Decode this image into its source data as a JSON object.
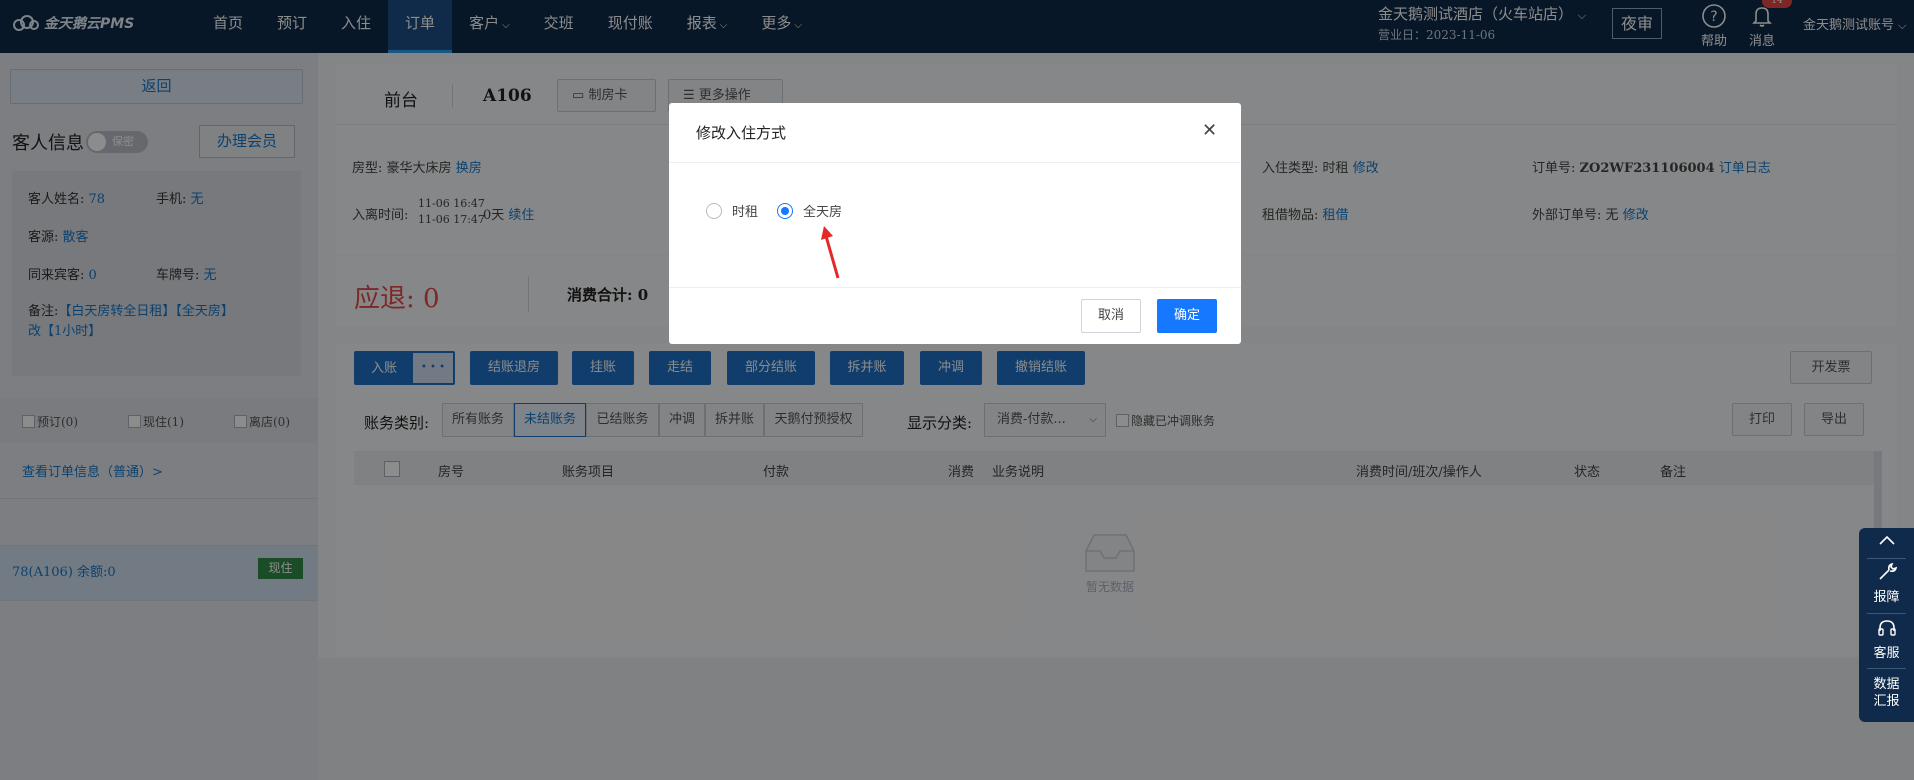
{
  "brand": {
    "name": "金天鹅云PMS"
  },
  "nav": [
    {
      "label": "首页",
      "dropdown": false,
      "active": false
    },
    {
      "label": "预订",
      "dropdown": false,
      "active": false
    },
    {
      "label": "入住",
      "dropdown": false,
      "active": false
    },
    {
      "label": "订单",
      "dropdown": false,
      "active": true
    },
    {
      "label": "客户",
      "dropdown": true,
      "active": false
    },
    {
      "label": "交班",
      "dropdown": false,
      "active": false
    },
    {
      "label": "现付账",
      "dropdown": false,
      "active": false
    },
    {
      "label": "报表",
      "dropdown": true,
      "active": false
    },
    {
      "label": "更多",
      "dropdown": true,
      "active": false
    }
  ],
  "topright": {
    "hotel": "金天鹅测试酒店（火车站店）",
    "business_date": "营业日：2023-11-06",
    "night_audit": "夜审",
    "help": "帮助",
    "messages": "消息",
    "message_badge": "14",
    "account": "金天鹅测试账号"
  },
  "sidebar": {
    "back": "返回",
    "guest_title": "客人信息",
    "privacy_toggle": "保密",
    "vip_button": "办理会员",
    "guest": {
      "name_label": "客人姓名:",
      "name_value": "78",
      "phone_label": "手机:",
      "phone_value": "无",
      "source_label": "客源:",
      "source_value": "散客",
      "companions_label": "同来宾客:",
      "companions_value": "0",
      "plate_label": "车牌号:",
      "plate_value": "无",
      "remark_label": "备注:",
      "remark_line1": "【白天房转全日租】【全天房】",
      "remark_line2": "改【1小时】"
    },
    "filters": [
      "预订(0)",
      "现住(1)",
      "离店(0)"
    ],
    "view_order": "查看订单信息（普通）>",
    "room_entry": "78(A106)   余额:0",
    "room_status": "现住"
  },
  "main": {
    "section": "前台",
    "room_no": "A106",
    "make_card": "制房卡",
    "more_ops": "更多操作",
    "room_type_label": "房型:",
    "room_type_value": "豪华大床房",
    "change_room": "换房",
    "stay_label": "入离时间:",
    "checkin_time": "11-06 16:47",
    "checkout_time": "11-06 17:47",
    "stay_days": "0天",
    "extend": "续住",
    "checkin_type_label": "入住类型:",
    "checkin_type_value": "时租",
    "modify": "修改",
    "order_no_label": "订单号:",
    "order_no_value": "ZO2WF231106004",
    "order_log": "订单日志",
    "rental_label": "租借物品:",
    "rental_link": "租借",
    "external_label": "外部订单号:",
    "external_value": "无",
    "external_modify": "修改",
    "refund_label": "应退:",
    "refund_value": "0",
    "consumption_label": "消费合计:",
    "consumption_value": "0",
    "actions": [
      "入账",
      "结账退房",
      "挂账",
      "走结",
      "部分结账",
      "拆并账",
      "冲调",
      "撤销结账"
    ],
    "more_dots": "• • •",
    "invoice": "开发票",
    "bill_category_label": "账务类别:",
    "bill_tabs": [
      {
        "label": "所有账务",
        "active": false
      },
      {
        "label": "未结账务",
        "active": true
      },
      {
        "label": "已结账务",
        "active": false
      },
      {
        "label": "冲调",
        "active": false
      },
      {
        "label": "拆并账",
        "active": false
      },
      {
        "label": "天鹅付预授权",
        "active": false
      }
    ],
    "display_label": "显示分类:",
    "display_select": "消费-付款...",
    "hide_adjust": "隐藏已冲调账务",
    "print": "打印",
    "export": "导出",
    "columns": [
      "房号",
      "账务项目",
      "付款",
      "消费",
      "业务说明",
      "消费时间/班次/操作人",
      "状态",
      "备注"
    ],
    "empty_text": "暂无数据"
  },
  "dock": {
    "report_issue": "报障",
    "service": "客服",
    "data_summary_1": "数据",
    "data_summary_2": "汇报"
  },
  "modal": {
    "title": "修改入住方式",
    "options": [
      {
        "label": "时租",
        "selected": false
      },
      {
        "label": "全天房",
        "selected": true
      }
    ],
    "cancel": "取消",
    "confirm": "确定"
  },
  "colors": {
    "topbar": "#0f2a4a",
    "accent": "#1677ff",
    "refund_red": "#e24a4a",
    "status_green": "#2e8b47"
  }
}
